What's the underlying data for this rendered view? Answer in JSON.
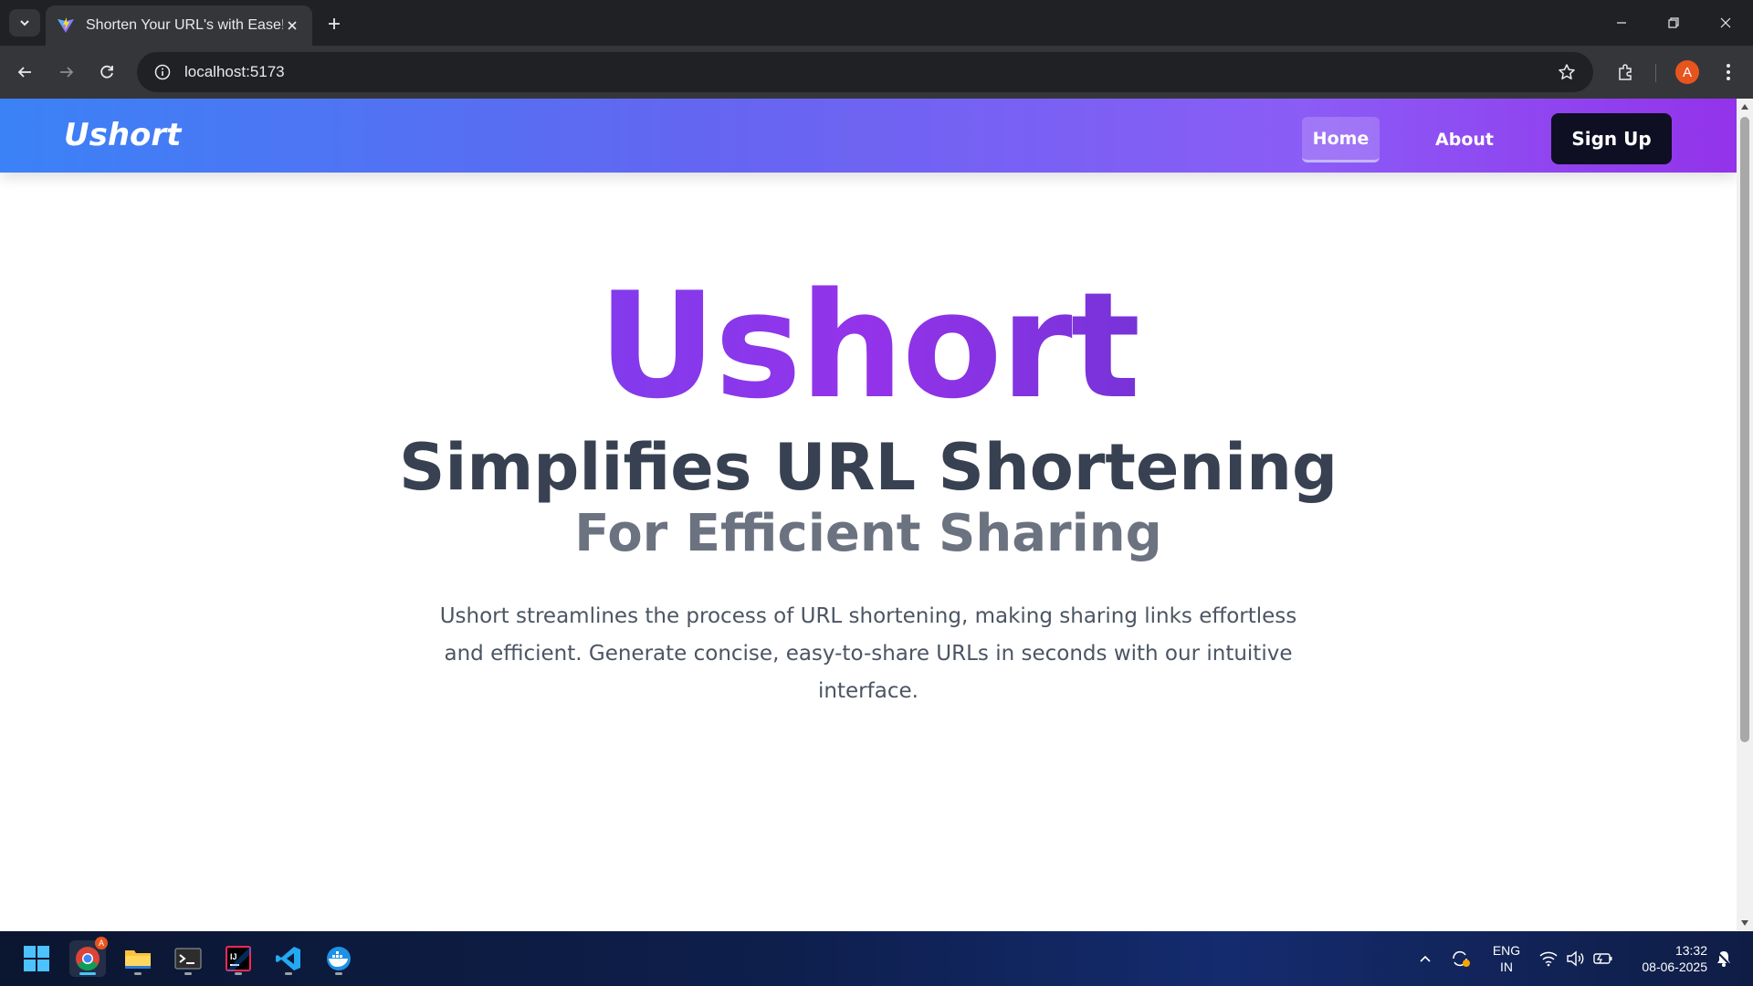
{
  "browser": {
    "tab_title": "Shorten Your URL's with Ease!",
    "url": "localhost:5173",
    "profile_initial": "A"
  },
  "navbar": {
    "brand": "Ushort",
    "links": [
      {
        "label": "Home",
        "active": true
      },
      {
        "label": "About",
        "active": false
      }
    ],
    "cta_label": "Sign Up"
  },
  "hero": {
    "title": "Ushort",
    "subtitle": "Simplifies URL Shortening",
    "subtitle2": "For Efficient Sharing",
    "description": "Ushort streamlines the process of URL shortening, making sharing links effortless and efficient. Generate concise, easy-to-share URLs in seconds with our intuitive interface."
  },
  "taskbar": {
    "apps": [
      "windows-start",
      "chrome",
      "file-explorer",
      "terminal",
      "intellij",
      "vscode",
      "docker"
    ],
    "chrome_badge": "A",
    "language": "ENG",
    "region": "IN",
    "time": "13:32",
    "date": "08-06-2025"
  },
  "colors": {
    "nav_gradient_start": "#3b82f6",
    "nav_gradient_end": "#9333ea",
    "signup_bg": "#0f0f24",
    "hero_title_gradient": [
      "#5b4ef0",
      "#9333ea",
      "#3b32b0"
    ],
    "subtitle_color": "#374151"
  }
}
